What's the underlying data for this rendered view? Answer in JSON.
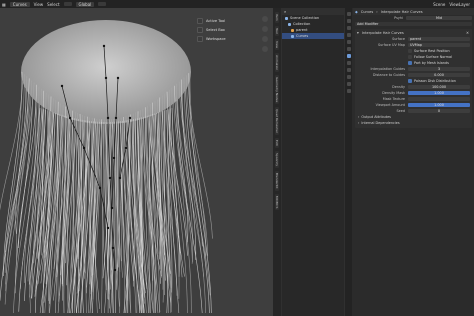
{
  "topbar": {
    "mode": "Curves",
    "view": "View",
    "select": "Select",
    "global": "Global",
    "scene_label": "Scene",
    "layer_label": "ViewLayer"
  },
  "overlay": {
    "items": [
      "Active Tool",
      "Select Box",
      "Workspace"
    ]
  },
  "side_tabs": [
    "Item",
    "Tool",
    "View",
    "Animation",
    "Geometry Nodes",
    "Quad Remesher",
    "Edit",
    "Spoonify",
    "BlenderKit",
    "MIOMCS"
  ],
  "outliner": {
    "rows": [
      "Scene Collection",
      "Collection",
      "parent",
      "Curves"
    ]
  },
  "props": {
    "object_name": "Curves",
    "modifier_name": "Interpolate Hair Curves",
    "top_fields": [
      {
        "label": "Psyhi",
        "value": "Mid"
      },
      {
        "label": "Add Modifier",
        "value": ""
      }
    ],
    "add_modifier": "Add Modifier",
    "rows": [
      {
        "label": "Surface",
        "value": "parent",
        "kind": "field"
      },
      {
        "label": "Surface UV Map",
        "value": "UVMap",
        "kind": "field"
      },
      {
        "label": "",
        "value": "Surface Rest Position",
        "kind": "check",
        "on": false
      },
      {
        "label": "",
        "value": "Follow Surface Normal",
        "kind": "check",
        "on": false
      },
      {
        "label": "",
        "value": "Part by Mesh Islands",
        "kind": "check",
        "on": true
      },
      {
        "label": "Interpolation Guides",
        "value": "3",
        "kind": "field"
      },
      {
        "label": "Distance to Guides",
        "value": "0.000",
        "kind": "field"
      },
      {
        "label": "",
        "value": "Poisson Disk Distribution",
        "kind": "check",
        "on": true
      },
      {
        "label": "Density",
        "value": "100.000",
        "kind": "field"
      },
      {
        "label": "Density Mask",
        "value": "1.000",
        "kind": "blue"
      },
      {
        "label": "Mask Texture",
        "value": "",
        "kind": "field"
      },
      {
        "label": "Viewport Amount",
        "value": "1.000",
        "kind": "blue"
      },
      {
        "label": "Seed",
        "value": "0",
        "kind": "field"
      }
    ],
    "sections": [
      "Output Attributes",
      "Internal Dependencies"
    ]
  }
}
